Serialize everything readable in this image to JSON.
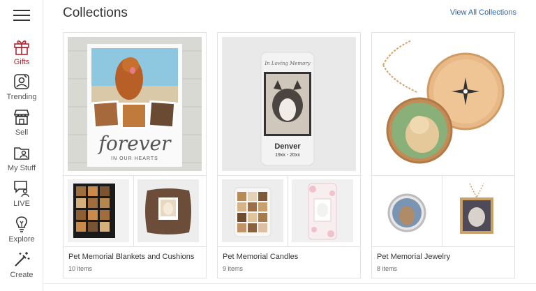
{
  "header": {
    "title": "Collections",
    "view_all": "View All Collections"
  },
  "sidebar": {
    "items": [
      {
        "label": "Gifts",
        "icon": "gift-icon",
        "active": true
      },
      {
        "label": "Trending",
        "icon": "trending-icon",
        "active": false
      },
      {
        "label": "Sell",
        "icon": "store-icon",
        "active": false
      },
      {
        "label": "My Stuff",
        "icon": "folder-user-icon",
        "active": false
      },
      {
        "label": "LIVE",
        "icon": "chat-user-icon",
        "active": false
      },
      {
        "label": "Explore",
        "icon": "lightbulb-icon",
        "active": false
      },
      {
        "label": "Create",
        "icon": "magic-wand-icon",
        "active": false
      }
    ]
  },
  "collections": [
    {
      "name": "Pet Memorial Blankets and Cushions",
      "count": "10 items",
      "main_text": "forever",
      "main_subtext": "IN OUR HEARTS"
    },
    {
      "name": "Pet Memorial Candles",
      "count": "9 items",
      "main_text": "In Loving Memory",
      "pet_name": "Denver",
      "pet_years": "19xx - 20xx"
    },
    {
      "name": "Pet Memorial Jewelry",
      "count": "8 items"
    }
  ],
  "colors": {
    "accent_active": "#b4232f",
    "link": "#2763a8"
  }
}
